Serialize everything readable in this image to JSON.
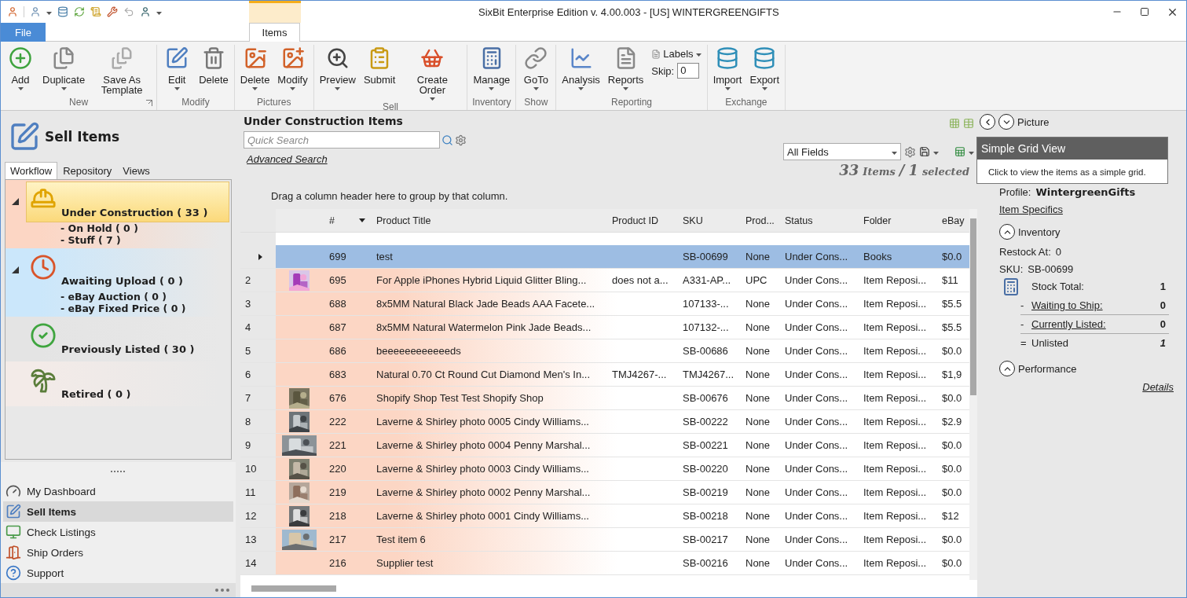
{
  "window": {
    "title": "SixBit Enterprise Edition v. 4.00.003 - [US] WINTERGREENGIFTS"
  },
  "ribbon_tabs": [
    {
      "label": "File",
      "kind": "file",
      "selected": false
    },
    {
      "label": "Items",
      "kind": "tab",
      "selected": true
    }
  ],
  "ribbon_groups": [
    {
      "label": "New",
      "launcher": true,
      "items": [
        {
          "kind": "button",
          "label": "Add",
          "dropdown": true
        },
        {
          "kind": "button",
          "label": "Duplicate",
          "dropdown": true
        },
        {
          "kind": "button",
          "label": "Save As Template",
          "dropdown": false
        }
      ]
    },
    {
      "label": "Modify",
      "launcher": false,
      "items": [
        {
          "kind": "button",
          "label": "Edit",
          "dropdown": true
        },
        {
          "kind": "button",
          "label": "Delete",
          "dropdown": false
        }
      ]
    },
    {
      "label": "Pictures",
      "launcher": false,
      "items": [
        {
          "kind": "button",
          "label": "Delete",
          "dropdown": true
        },
        {
          "kind": "button",
          "label": "Modify",
          "dropdown": true
        }
      ]
    },
    {
      "label": "Sell",
      "launcher": false,
      "items": [
        {
          "kind": "button",
          "label": "Preview",
          "dropdown": true
        },
        {
          "kind": "button",
          "label": "Submit",
          "dropdown": false
        },
        {
          "kind": "button",
          "label": "Create Order",
          "dropdown": true
        }
      ]
    },
    {
      "label": "Inventory",
      "launcher": false,
      "items": [
        {
          "kind": "button",
          "label": "Manage",
          "dropdown": true
        }
      ]
    },
    {
      "label": "Show",
      "launcher": false,
      "items": [
        {
          "kind": "button",
          "label": "GoTo",
          "dropdown": true
        }
      ]
    },
    {
      "label": "Reporting",
      "launcher": false,
      "items": [
        {
          "kind": "button",
          "label": "Analysis",
          "dropdown": true
        },
        {
          "kind": "button",
          "label": "Reports",
          "dropdown": true
        },
        {
          "kind": "labels",
          "label": "Labels",
          "skip_label": "Skip:",
          "skip_value": "0"
        }
      ]
    },
    {
      "label": "Exchange",
      "launcher": false,
      "items": [
        {
          "kind": "button",
          "label": "Import",
          "dropdown": true
        },
        {
          "kind": "button",
          "label": "Export",
          "dropdown": true
        }
      ]
    }
  ],
  "sidebar": {
    "title": "Sell Items",
    "tabs": [
      {
        "label": "Workflow",
        "selected": true
      },
      {
        "label": "Repository",
        "selected": false
      },
      {
        "label": "Views",
        "selected": false
      }
    ],
    "tree": [
      {
        "label": "Under Construction ( 33 )",
        "selected": true,
        "expanded": true,
        "color": "#fcd6c4",
        "children": [
          {
            "label": "- On Hold ( 0 )"
          },
          {
            "label": "- Stuff ( 7 )"
          }
        ]
      },
      {
        "label": "Awaiting Upload ( 0 )",
        "selected": false,
        "expanded": true,
        "color": "#cbe7fb",
        "children": [
          {
            "label": "- eBay Auction ( 0 )"
          },
          {
            "label": "- eBay Fixed Price ( 0 )"
          }
        ]
      },
      {
        "label": "Previously Listed ( 30 )",
        "selected": false,
        "color": "#e4e4e4"
      },
      {
        "label": "Retired ( 0 )",
        "selected": false,
        "color": "#f3ebe8"
      }
    ],
    "nav": [
      {
        "label": "My Dashboard",
        "selected": false
      },
      {
        "label": "Sell Items",
        "selected": true
      },
      {
        "label": "Check Listings",
        "selected": false
      },
      {
        "label": "Ship Orders",
        "selected": false
      },
      {
        "label": "Support",
        "selected": false
      }
    ]
  },
  "view": {
    "title": "Under Construction Items",
    "search": {
      "placeholder": "Quick Search"
    },
    "advanced_search": "Advanced Search",
    "field_filter": "All Fields",
    "count": "33",
    "count_label": "Items",
    "separator": "/",
    "selected_count": "1",
    "selected_label": "selected",
    "group_hint": "Drag a column header here to group by that column."
  },
  "grid": {
    "columns": [
      {
        "label": "#",
        "sorted": true
      },
      {
        "label": "Product Title",
        "sorted": false
      },
      {
        "label": "Product ID",
        "sorted": false
      },
      {
        "label": "SKU",
        "sorted": false
      },
      {
        "label": "Prod...",
        "sorted": false
      },
      {
        "label": "Status",
        "sorted": false
      },
      {
        "label": "Folder",
        "sorted": false
      },
      {
        "label": "eBay",
        "sorted": false
      }
    ],
    "rows": [
      {
        "selected": true,
        "thumbnail": false,
        "number": "699",
        "title": "test",
        "sku": "SB-00699",
        "prod": "None",
        "status": "Under Cons...",
        "folder": "Books",
        "ebay": "$0.0"
      },
      {
        "row_number": "2",
        "selected": false,
        "thumbnail": true,
        "number": "695",
        "title": "For Apple iPhones Hybrid Liquid Glitter Bling...",
        "product_id": "does not a...",
        "sku": "A331-AP...",
        "prod": "UPC",
        "status": "Under Cons...",
        "folder": "Item Reposi...",
        "ebay": "$11"
      },
      {
        "row_number": "3",
        "selected": false,
        "thumbnail": false,
        "number": "688",
        "title": "8x5MM Natural Black Jade Beads AAA Facete...",
        "sku": "107133-...",
        "prod": "None",
        "status": "Under Cons...",
        "folder": "Item Reposi...",
        "ebay": "$5.5"
      },
      {
        "row_number": "4",
        "selected": false,
        "thumbnail": false,
        "number": "687",
        "title": "8x5MM Natural Watermelon Pink Jade Beads...",
        "sku": "107132-...",
        "prod": "None",
        "status": "Under Cons...",
        "folder": "Item Reposi...",
        "ebay": "$5.5"
      },
      {
        "row_number": "5",
        "selected": false,
        "thumbnail": false,
        "number": "686",
        "title": "beeeeeeeeeeeeds",
        "sku": "SB-00686",
        "prod": "None",
        "status": "Under Cons...",
        "folder": "Item Reposi...",
        "ebay": "$0.0"
      },
      {
        "row_number": "6",
        "selected": false,
        "thumbnail": false,
        "number": "683",
        "title": "Natural 0.70 Ct Round Cut Diamond Men's In...",
        "product_id": "TMJ4267-...",
        "sku": "TMJ4267...",
        "prod": "None",
        "status": "Under Cons...",
        "folder": "Item Reposi...",
        "ebay": "$1,9"
      },
      {
        "row_number": "7",
        "selected": false,
        "thumbnail": true,
        "number": "676",
        "title": "Shopify Shop Test Test Shopify Shop",
        "sku": "SB-00676",
        "prod": "None",
        "status": "Under Cons...",
        "folder": "Item Reposi...",
        "ebay": "$0.0"
      },
      {
        "row_number": "8",
        "selected": false,
        "thumbnail": true,
        "number": "222",
        "title": "Laverne & Shirley photo 0005 Cindy Williams...",
        "sku": "SB-00222",
        "prod": "None",
        "status": "Under Cons...",
        "folder": "Item Reposi...",
        "ebay": "$2.9"
      },
      {
        "row_number": "9",
        "selected": false,
        "thumbnail": true,
        "number": "221",
        "title": "Laverne & Shirley photo 0004 Penny Marshal...",
        "sku": "SB-00221",
        "prod": "None",
        "status": "Under Cons...",
        "folder": "Item Reposi...",
        "ebay": "$0.0"
      },
      {
        "row_number": "10",
        "selected": false,
        "thumbnail": true,
        "number": "220",
        "title": "Laverne & Shirley photo 0003 Cindy Williams...",
        "sku": "SB-00220",
        "prod": "None",
        "status": "Under Cons...",
        "folder": "Item Reposi...",
        "ebay": "$0.0"
      },
      {
        "row_number": "11",
        "selected": false,
        "thumbnail": true,
        "number": "219",
        "title": "Laverne & Shirley photo 0002 Penny Marshal...",
        "sku": "SB-00219",
        "prod": "None",
        "status": "Under Cons...",
        "folder": "Item Reposi...",
        "ebay": "$0.0"
      },
      {
        "row_number": "12",
        "selected": false,
        "thumbnail": true,
        "number": "218",
        "title": "Laverne & Shirley photo 0001 Cindy Williams...",
        "sku": "SB-00218",
        "prod": "None",
        "status": "Under Cons...",
        "folder": "Item Reposi...",
        "ebay": "$12"
      },
      {
        "row_number": "13",
        "selected": false,
        "thumbnail": true,
        "number": "217",
        "title": "Test item 6",
        "sku": "SB-00217",
        "prod": "None",
        "status": "Under Cons...",
        "folder": "Item Reposi...",
        "ebay": "$0.0"
      },
      {
        "row_number": "14",
        "selected": false,
        "thumbnail": false,
        "number": "216",
        "title": "Supplier test",
        "sku": "SB-00216",
        "prod": "None",
        "status": "Under Cons...",
        "folder": "Item Reposi...",
        "ebay": "$0.0"
      }
    ]
  },
  "details": {
    "picture": {
      "label": "Picture",
      "expanded": false
    },
    "profile_label": "Profile:",
    "profile": "WintergreenGifts",
    "item_specifics": "Item Specifics",
    "inventory": {
      "label": "Inventory",
      "expanded": true,
      "restock_label": "Restock At:",
      "restock": "0",
      "sku_label": "SKU:",
      "sku": "SB-00699",
      "lines": [
        {
          "kind": "plain",
          "label": "Stock Total:",
          "value": "1"
        },
        {
          "kind": "link",
          "prefix": "-",
          "label": "Waiting to Ship:",
          "value": "0"
        },
        {
          "kind": "link",
          "prefix": "-",
          "label": "Currently Listed:",
          "value": "0"
        },
        {
          "kind": "total",
          "prefix": "=",
          "label": "Unlisted",
          "value": "1"
        }
      ]
    },
    "performance": {
      "label": "Performance",
      "expanded": true
    },
    "details_link": "Details"
  },
  "tooltip": {
    "title": "Simple Grid View",
    "text": "Click to view the items as a simple grid."
  }
}
